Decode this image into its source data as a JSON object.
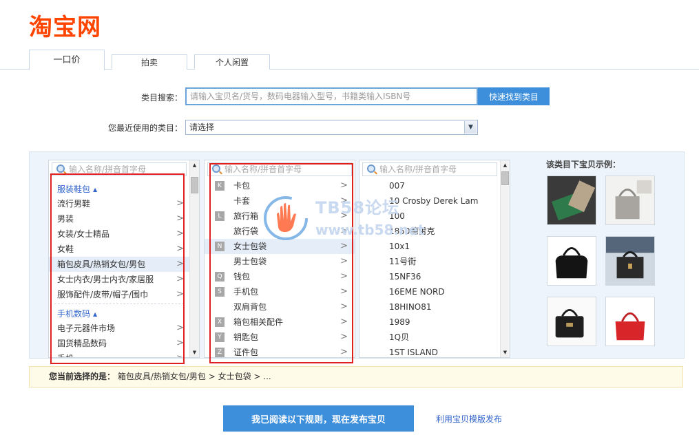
{
  "brand": {
    "logo_text": "淘宝网",
    "logo_color": "#ff4400"
  },
  "tabs": [
    {
      "label": "一口价",
      "active": true
    },
    {
      "label": "拍卖",
      "active": false
    },
    {
      "label": "个人闲置",
      "active": false
    }
  ],
  "category_search": {
    "label": "类目搜索：",
    "placeholder": "请输入宝贝名/货号，数码电器输入型号，书籍类输入ISBN号",
    "button_label": "快速找到类目"
  },
  "recent": {
    "label": "您最近使用的类目：",
    "selected": "请选择"
  },
  "column1": {
    "search_placeholder": "输入名称/拼音首字母",
    "groups": [
      {
        "title": "服装鞋包",
        "items": [
          "流行男鞋",
          "男装",
          "女装/女士精品",
          "女鞋",
          "箱包皮具/热销女包/男包",
          "女士内衣/男士内衣/家居服",
          "服饰配件/皮带/帽子/围巾"
        ]
      },
      {
        "title": "手机数码",
        "items": [
          "电子元器件市场",
          "国货精品数码",
          "手机"
        ]
      }
    ],
    "selected_item": "箱包皮具/热销女包/男包"
  },
  "column2": {
    "search_placeholder": "输入名称/拼音首字母",
    "items": [
      {
        "letter": "K",
        "label": "卡包"
      },
      {
        "letter": "",
        "label": "卡套"
      },
      {
        "letter": "L",
        "label": "旅行箱"
      },
      {
        "letter": "",
        "label": "旅行袋"
      },
      {
        "letter": "N",
        "label": "女士包袋"
      },
      {
        "letter": "",
        "label": "男士包袋"
      },
      {
        "letter": "Q",
        "label": "钱包"
      },
      {
        "letter": "S",
        "label": "手机包"
      },
      {
        "letter": "",
        "label": "双肩背包"
      },
      {
        "letter": "X",
        "label": "箱包相关配件"
      },
      {
        "letter": "Y",
        "label": "钥匙包"
      },
      {
        "letter": "Z",
        "label": "证件包"
      }
    ],
    "selected_item": "女士包袋"
  },
  "column3": {
    "search_placeholder": "输入名称/拼音首字母",
    "items": [
      "007",
      "10 Crosby Derek Lam",
      "100",
      "1850德雷克",
      "10x1",
      "11号街",
      "15NF36",
      "16EME NORD",
      "18HINO81",
      "1989",
      "1Q贝",
      "1ST ISLAND"
    ]
  },
  "examples": {
    "title": "该类目下宝贝示例："
  },
  "watermark": {
    "line1": "TB58论坛",
    "line2": "www.tb58.net"
  },
  "selection": {
    "label": "您当前选择的是：",
    "path": "箱包皮具/热销女包/男包 > 女士包袋 > ..."
  },
  "actions": {
    "publish_label": "我已阅读以下规则，现在发布宝贝",
    "template_link": "利用宝贝模版发布"
  },
  "colors": {
    "accent": "#3d8fdc",
    "highlight_box": "#e02020",
    "link": "#3366cc"
  }
}
